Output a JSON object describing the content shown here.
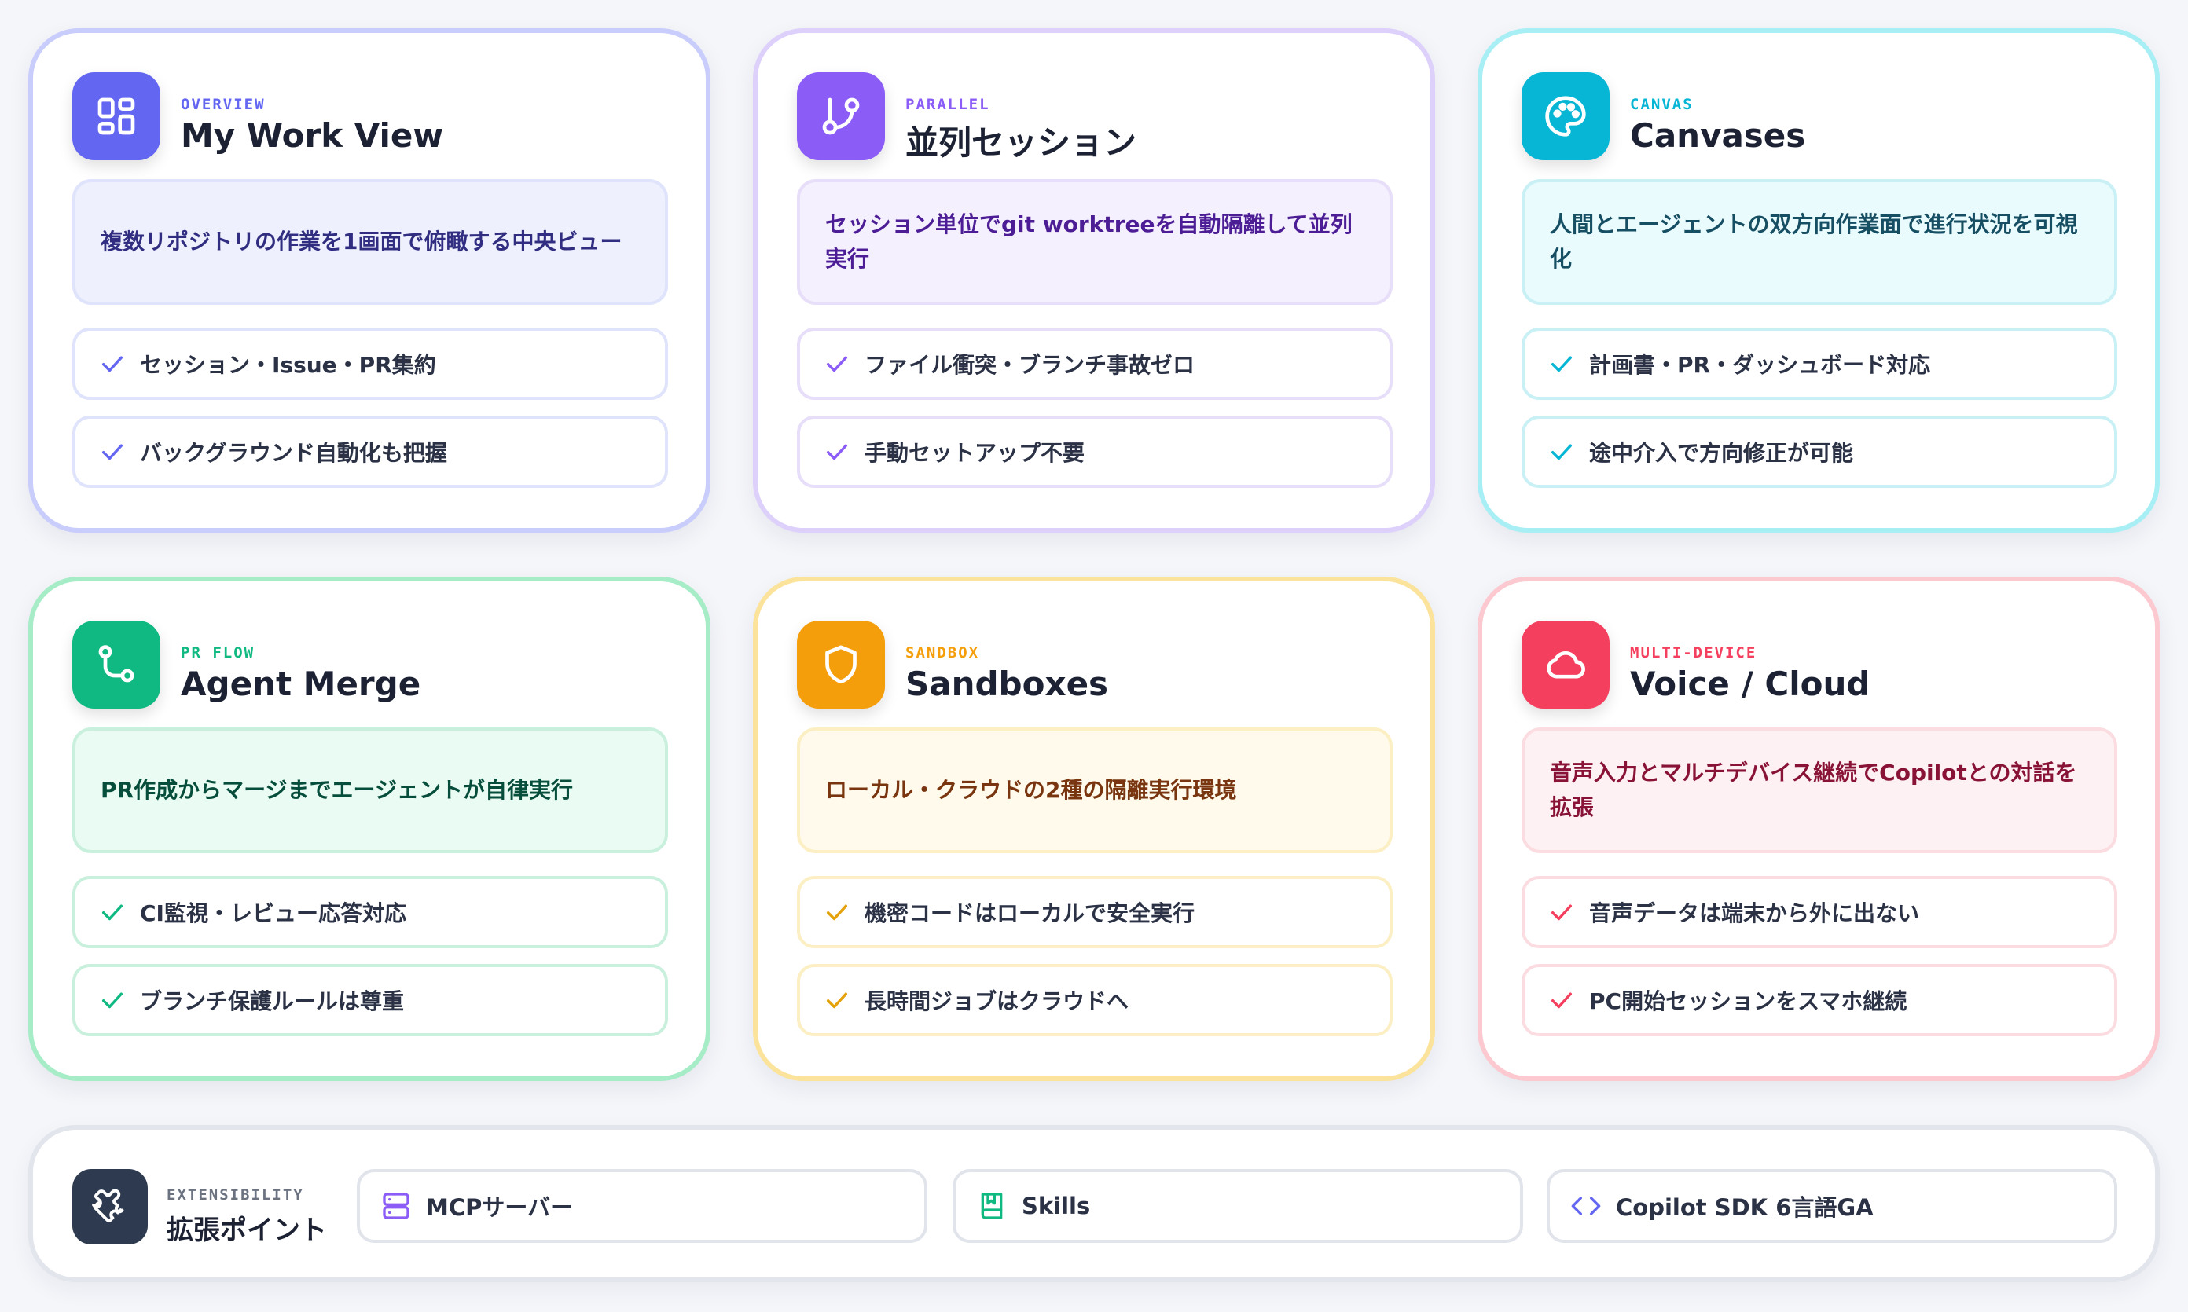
{
  "cards": [
    {
      "tag": "OVERVIEW",
      "title": "My Work View",
      "icon": "layout-grid-icon",
      "description": "複数リポジトリの作業を1画面で俯瞰する中央ビュー",
      "features": [
        "セッション・Issue・PR集約",
        "バックグラウンド自動化も把握"
      ],
      "accent": "#6366f1"
    },
    {
      "tag": "PARALLEL",
      "title": "並列セッション",
      "icon": "git-branch-icon",
      "description": "セッション単位でgit worktreeを自動隔離して並列実行",
      "features": [
        "ファイル衝突・ブランチ事故ゼロ",
        "手動セットアップ不要"
      ],
      "accent": "#8b5cf6"
    },
    {
      "tag": "CANVAS",
      "title": "Canvases",
      "icon": "palette-icon",
      "description": "人間とエージェントの双方向作業面で進行状況を可視化",
      "features": [
        "計画書・PR・ダッシュボード対応",
        "途中介入で方向修正が可能"
      ],
      "accent": "#06b6d4"
    },
    {
      "tag": "PR FLOW",
      "title": "Agent Merge",
      "icon": "git-merge-icon",
      "description": "PR作成からマージまでエージェントが自律実行",
      "features": [
        "CI監視・レビュー応答対応",
        "ブランチ保護ルールは尊重"
      ],
      "accent": "#10b981"
    },
    {
      "tag": "SANDBOX",
      "title": "Sandboxes",
      "icon": "shield-icon",
      "description": "ローカル・クラウドの2種の隔離実行環境",
      "features": [
        "機密コードはローカルで安全実行",
        "長時間ジョブはクラウドへ"
      ],
      "accent": "#f59e0b"
    },
    {
      "tag": "MULTI-DEVICE",
      "title": "Voice / Cloud",
      "icon": "cloud-icon",
      "description": "音声入力とマルチデバイス継続でCopilotとの対話を拡張",
      "features": [
        "音声データは端末から外に出ない",
        "PC開始セッションをスマホ継続"
      ],
      "accent": "#f43f5e"
    }
  ],
  "extensibility": {
    "tag": "EXTENSIBILITY",
    "title": "拡張ポイント",
    "icon": "puzzle-icon",
    "items": [
      {
        "label": "MCPサーバー",
        "icon": "server-icon",
        "color": "#8b5cf6"
      },
      {
        "label": "Skills",
        "icon": "book-icon",
        "color": "#10b981"
      },
      {
        "label": "Copilot SDK 6言語GA",
        "icon": "code-icon",
        "color": "#6366f1"
      }
    ]
  }
}
